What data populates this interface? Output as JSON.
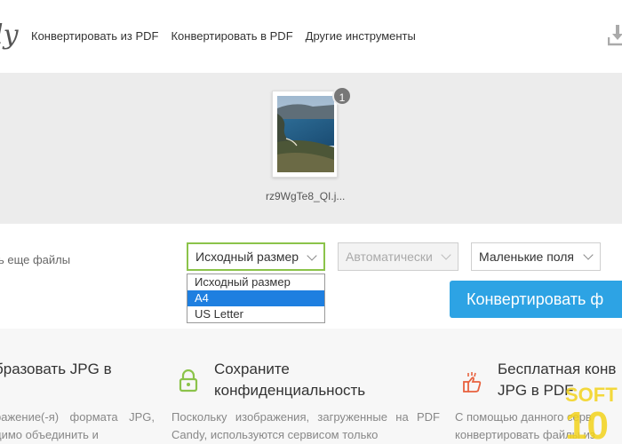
{
  "header": {
    "logo_text": "ly",
    "nav": [
      "Конвертировать из PDF",
      "Конвертировать в PDF",
      "Другие инструменты"
    ],
    "icons": {
      "download": "download-icon"
    }
  },
  "upload": {
    "file_count": "1",
    "filename": "rz9WgTe8_QI.j..."
  },
  "controls": {
    "add_files_label": "ть еще файлы",
    "page_size_value": "Исходный размер",
    "orientation_value": "Автоматически",
    "margin_value": "Маленькие поля",
    "page_size_options": [
      "Исходный размер",
      "A4",
      "US Letter"
    ],
    "page_size_highlighted": "A4",
    "convert_label": "Конвертировать ф"
  },
  "info": {
    "col1": {
      "title": "бразовать JPG в",
      "text": "ражение(-я) формата JPG, димо объединить и"
    },
    "col2": {
      "title": "Сохраните конфиденциальность",
      "text": "Поскольку изображения, загруженные на PDF Candy, используются сервисом только",
      "icon": "lock-icon"
    },
    "col3": {
      "title_line1": "Бесплатная конв",
      "title_line2": "JPG в PDF",
      "text_line1": "С помощью данного серв",
      "text_line2": "конвертировать файлы из",
      "icon": "thumbs-up-icon"
    }
  },
  "watermark": {
    "line1": "SOFT",
    "line2": "10"
  },
  "colors": {
    "accent_blue": "#2da3e4",
    "highlight_green": "#8bc34a",
    "lock_green": "#8bc34a",
    "thumbs_orange": "#e8623f"
  }
}
